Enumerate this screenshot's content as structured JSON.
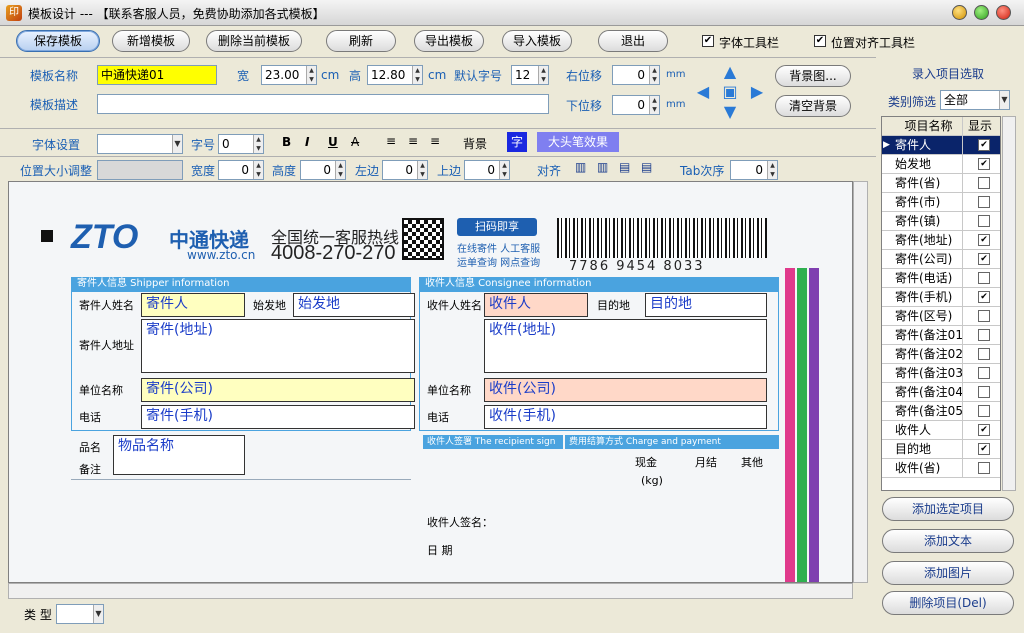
{
  "window": {
    "title": "模板设计 --- 【联系客服人员，免费协助添加各式模板】"
  },
  "toolbar": {
    "save": "保存模板",
    "new": "新增模板",
    "delete": "删除当前模板",
    "refresh": "刷新",
    "export": "导出模板",
    "import": "导入模板",
    "exit": "退出",
    "font_toolbar": "字体工具栏",
    "align_toolbar": "位置对齐工具栏"
  },
  "template": {
    "name_label": "模板名称",
    "name_value": "中通快递01",
    "desc_label": "模板描述",
    "desc_value": "",
    "width_label": "宽",
    "width_value": "23.00",
    "width_unit": "cm",
    "height_label": "高",
    "height_value": "12.80",
    "height_unit": "cm",
    "fontsize_label": "默认字号",
    "fontsize_value": "12",
    "right_offset_label": "右位移",
    "right_offset_value": "0",
    "right_unit": "mm",
    "down_offset_label": "下位移",
    "down_offset_value": "0",
    "down_unit": "mm",
    "bg_button": "背景图...",
    "clear_bg_button": "清空背景"
  },
  "font_bar": {
    "font_label": "字体设置",
    "font_value": "",
    "size_label": "字号",
    "size_value": "0",
    "bold": "B",
    "italic": "I",
    "underline": "U",
    "strike": "A",
    "bg_label": "背景",
    "char_label": "字",
    "effect_label": "大头笔效果"
  },
  "pos_bar": {
    "label": "位置大小调整",
    "width_label": "宽度",
    "width_value": "0",
    "height_label": "高度",
    "height_value": "0",
    "left_label": "左边",
    "left_value": "0",
    "top_label": "上边",
    "top_value": "0",
    "align_label": "对齐",
    "tab_label": "Tab次序",
    "tab_value": "0"
  },
  "waybill": {
    "brand": "中通快递",
    "logo": "ZTO",
    "website": "www.zto.cn",
    "hotline_title": "全国统一客服热线",
    "hotline": "4008-270-270",
    "scan_badge": "扫码即享",
    "scan_items": [
      "在线寄件  人工客服",
      "运单查询  网点查询"
    ],
    "tracking": "7786  9454  8033",
    "shipper_info": "寄件人信息 Shipper information",
    "consignee_info": "收件人信息 Consignee information",
    "fields": {
      "sender": "寄件人",
      "origin": "始发地",
      "sender_addr": "寄件(地址)",
      "sender_company": "寄件(公司)",
      "sender_phone": "寄件(手机)",
      "receiver": "收件人",
      "dest": "目的地",
      "receiver_addr": "收件(地址)",
      "receiver_company": "收件(公司)",
      "receiver_phone": "收件(手机)",
      "goods": "物品名称"
    },
    "labels": {
      "sender_name": "寄件人姓名",
      "departure": "始发地",
      "address": "寄件人地址",
      "company": "单位名称",
      "phone": "电话",
      "receiver_name": "收件人姓名",
      "destination": "目的地",
      "goods_name": "品名",
      "remark": "备注",
      "recipient_sign": "收件人签署 The recipient sign",
      "charge": "费用结算方式 Charge and payment",
      "cash": "现金",
      "monthly": "月结",
      "other": "其他",
      "weight": "(kg)",
      "sign_name": "收件人签名：",
      "date": "日 期"
    }
  },
  "right": {
    "title": "录入项目选取",
    "filter_label": "类别筛选",
    "filter_value": "全部",
    "col_name": "项目名称",
    "col_show": "显示",
    "items": [
      {
        "name": "寄件人",
        "show": "✔"
      },
      {
        "name": "始发地",
        "show": "✔"
      },
      {
        "name": "寄件(省)",
        "show": ""
      },
      {
        "name": "寄件(市)",
        "show": ""
      },
      {
        "name": "寄件(镇)",
        "show": ""
      },
      {
        "name": "寄件(地址)",
        "show": "✔"
      },
      {
        "name": "寄件(公司)",
        "show": "✔"
      },
      {
        "name": "寄件(电话)",
        "show": ""
      },
      {
        "name": "寄件(手机)",
        "show": "✔"
      },
      {
        "name": "寄件(区号)",
        "show": ""
      },
      {
        "name": "寄件(备注01)",
        "show": ""
      },
      {
        "name": "寄件(备注02)",
        "show": ""
      },
      {
        "name": "寄件(备注03)",
        "show": ""
      },
      {
        "name": "寄件(备注04)",
        "show": ""
      },
      {
        "name": "寄件(备注05)",
        "show": ""
      },
      {
        "name": "收件人",
        "show": "✔"
      },
      {
        "name": "目的地",
        "show": "✔"
      },
      {
        "name": "收件(省)",
        "show": ""
      }
    ],
    "add_selected": "添加选定项目",
    "add_text": "添加文本",
    "add_image": "添加图片",
    "delete_item": "删除项目(Del)"
  },
  "bottom": {
    "type_label": "类 型",
    "type_value": ""
  }
}
